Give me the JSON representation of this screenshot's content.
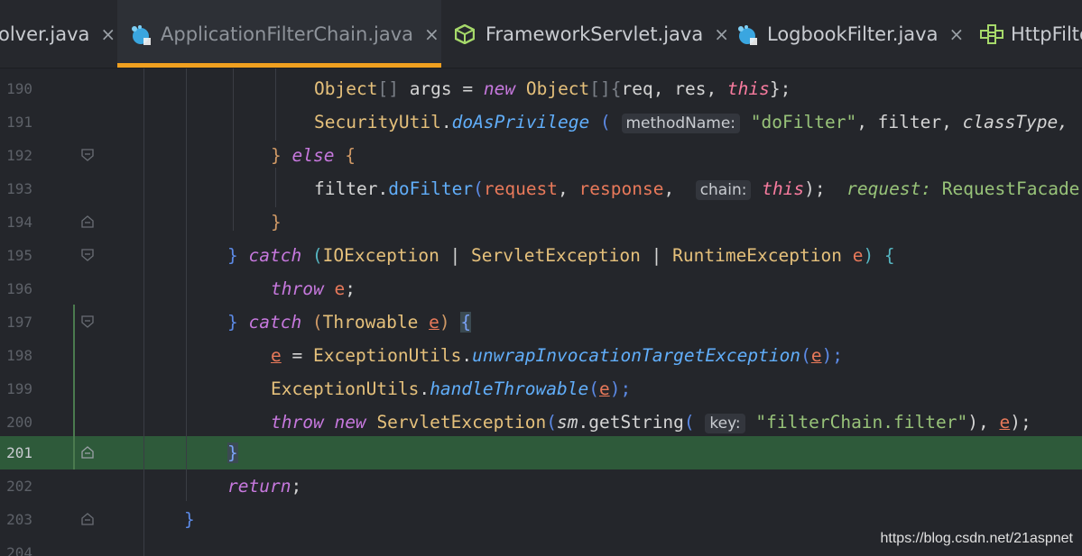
{
  "tabs": [
    {
      "title": "olver.java",
      "close": "×",
      "icon": "java-class-icon",
      "active": false
    },
    {
      "title": "ApplicationFilterChain.java",
      "close": "×",
      "icon": "java-class-icon",
      "active": true
    },
    {
      "title": "FrameworkServlet.java",
      "close": "×",
      "icon": "java-abstract-class-icon",
      "active": false
    },
    {
      "title": "LogbookFilter.java",
      "close": "×",
      "icon": "java-class-icon",
      "active": false
    },
    {
      "title": "HttpFilte",
      "close": "",
      "icon": "java-interface-icon",
      "active": false
    }
  ],
  "editor": {
    "current_line": "201",
    "line_numbers": [
      "190",
      "191",
      "192",
      "193",
      "194",
      "195",
      "196",
      "197",
      "198",
      "199",
      "200",
      "201",
      "202",
      "203",
      "204"
    ],
    "code": {
      "l190": {
        "t1": "Object",
        "t2": "[] ",
        "t3": "args = ",
        "t4": "new",
        "t5": " Object",
        "t6": "[]{",
        "t7": "req, res, ",
        "t8": "this",
        "t9": "};"
      },
      "l191": {
        "t1": "SecurityUtil",
        "t2": ".",
        "t3": "doAsPrivilege",
        "t4": " ( ",
        "hint": "methodName:",
        "t5": " ",
        "t6": "\"doFilter\"",
        "t7": ", filter, ",
        "t8": "classType,"
      },
      "l192": {
        "t1": "} ",
        "t2": "else",
        "t3": " {"
      },
      "l193": {
        "t1": "filter.",
        "t2": "doFilter",
        "t3": "(",
        "t4": "request",
        "t5": ", ",
        "t6": "response",
        "t7": ",  ",
        "hint": "chain:",
        "t8": " ",
        "t9": "this",
        "t10": ");  ",
        "t11": "request:",
        "t12": " RequestFacade"
      },
      "l194": {
        "t1": "}"
      },
      "l195": {
        "t1": "} ",
        "t2": "catch",
        "t3": " (",
        "t4": "IOException",
        "t5": " | ",
        "t6": "ServletException",
        "t7": " | ",
        "t8": "RuntimeException",
        "t9": " e",
        "t10": ") {"
      },
      "l196": {
        "t1": "throw",
        "t2": " e",
        "t3": ";"
      },
      "l197": {
        "t1": "} ",
        "t2": "catch",
        "t3": " (",
        "t4": "Throwable",
        "t5": " ",
        "t6": "e",
        "t7": ") ",
        "t8": "{"
      },
      "l198": {
        "t1": "e",
        "t2": " = ",
        "t3": "ExceptionUtils",
        "t4": ".",
        "t5": "unwrapInvocationTargetException",
        "t6": "(",
        "t7": "e",
        "t8": ");"
      },
      "l199": {
        "t1": "ExceptionUtils",
        "t2": ".",
        "t3": "handleThrowable",
        "t4": "(",
        "t5": "e",
        "t6": ");"
      },
      "l200": {
        "t1": "throw",
        "t2": " ",
        "t3": "new",
        "t4": " ",
        "t5": "ServletException",
        "t6": "(",
        "t7": "sm",
        "t8": ".getString",
        "t9": "( ",
        "hint": "key:",
        "t10": " ",
        "t11": "\"filterChain.filter\"",
        "t12": "), ",
        "t13": "e",
        "t14": ");"
      },
      "l201": {
        "t1": "}"
      },
      "l202": {
        "t1": "return",
        "t2": ";"
      },
      "l203": {
        "t1": "}"
      },
      "l204": {
        "t1": ""
      }
    }
  },
  "watermark": "https://blog.csdn.net/21aspnet",
  "colors": {
    "accent_tab_underline": "#f0a020",
    "current_line_bg": "#2e5a3a",
    "editor_bg": "#24262b"
  }
}
